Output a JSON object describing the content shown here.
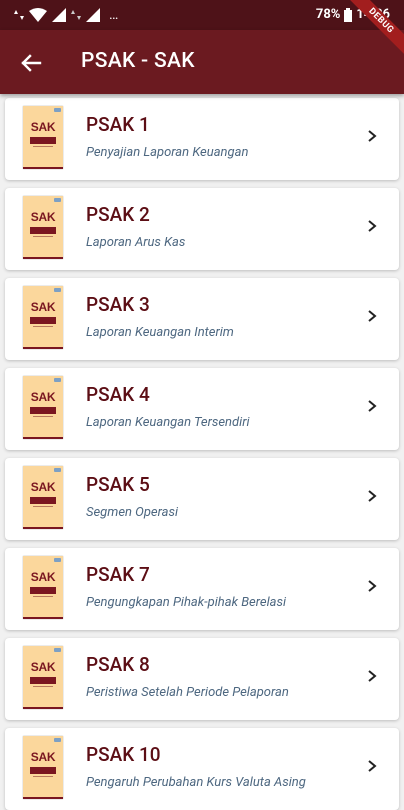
{
  "status_bar": {
    "battery": "78%",
    "time": "14.36",
    "left_icons": "▴▾ ▼ ◢◢ ◢ …"
  },
  "app_bar": {
    "title": "PSAK - SAK",
    "back_icon": "arrow-left-icon"
  },
  "debug_banner": "DEBUG",
  "colors": {
    "primary": "#6b1a20",
    "status_bar": "#4e1218",
    "title_text": "#5c0e15",
    "subtitle_text": "#4d6780",
    "cover": "#fbd79c"
  },
  "cover_label": "SAK",
  "items": [
    {
      "title": "PSAK 1",
      "subtitle": "Penyajian Laporan Keuangan"
    },
    {
      "title": "PSAK 2",
      "subtitle": "Laporan Arus Kas"
    },
    {
      "title": "PSAK 3",
      "subtitle": "Laporan Keuangan Interim"
    },
    {
      "title": "PSAK 4",
      "subtitle": "Laporan Keuangan Tersendiri"
    },
    {
      "title": "PSAK 5",
      "subtitle": "Segmen Operasi"
    },
    {
      "title": "PSAK 7",
      "subtitle": "Pengungkapan Pihak-pihak Berelasi"
    },
    {
      "title": "PSAK 8",
      "subtitle": "Peristiwa Setelah Periode Pelaporan"
    },
    {
      "title": "PSAK 10",
      "subtitle": "Pengaruh Perubahan Kurs Valuta Asing"
    }
  ]
}
